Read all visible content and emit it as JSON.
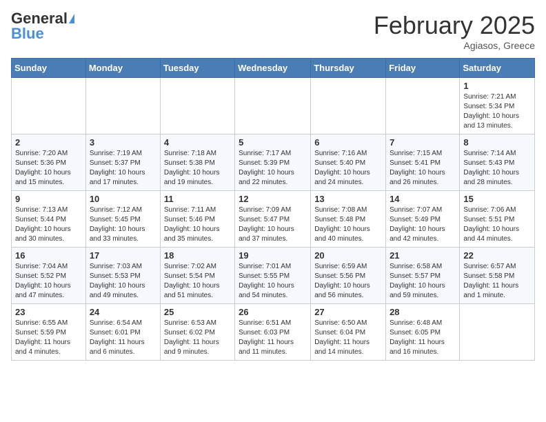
{
  "header": {
    "logo_general": "General",
    "logo_blue": "Blue",
    "title": "February 2025",
    "location": "Agiasos, Greece"
  },
  "weekdays": [
    "Sunday",
    "Monday",
    "Tuesday",
    "Wednesday",
    "Thursday",
    "Friday",
    "Saturday"
  ],
  "weeks": [
    [
      {
        "day": "",
        "info": ""
      },
      {
        "day": "",
        "info": ""
      },
      {
        "day": "",
        "info": ""
      },
      {
        "day": "",
        "info": ""
      },
      {
        "day": "",
        "info": ""
      },
      {
        "day": "",
        "info": ""
      },
      {
        "day": "1",
        "info": "Sunrise: 7:21 AM\nSunset: 5:34 PM\nDaylight: 10 hours\nand 13 minutes."
      }
    ],
    [
      {
        "day": "2",
        "info": "Sunrise: 7:20 AM\nSunset: 5:36 PM\nDaylight: 10 hours\nand 15 minutes."
      },
      {
        "day": "3",
        "info": "Sunrise: 7:19 AM\nSunset: 5:37 PM\nDaylight: 10 hours\nand 17 minutes."
      },
      {
        "day": "4",
        "info": "Sunrise: 7:18 AM\nSunset: 5:38 PM\nDaylight: 10 hours\nand 19 minutes."
      },
      {
        "day": "5",
        "info": "Sunrise: 7:17 AM\nSunset: 5:39 PM\nDaylight: 10 hours\nand 22 minutes."
      },
      {
        "day": "6",
        "info": "Sunrise: 7:16 AM\nSunset: 5:40 PM\nDaylight: 10 hours\nand 24 minutes."
      },
      {
        "day": "7",
        "info": "Sunrise: 7:15 AM\nSunset: 5:41 PM\nDaylight: 10 hours\nand 26 minutes."
      },
      {
        "day": "8",
        "info": "Sunrise: 7:14 AM\nSunset: 5:43 PM\nDaylight: 10 hours\nand 28 minutes."
      }
    ],
    [
      {
        "day": "9",
        "info": "Sunrise: 7:13 AM\nSunset: 5:44 PM\nDaylight: 10 hours\nand 30 minutes."
      },
      {
        "day": "10",
        "info": "Sunrise: 7:12 AM\nSunset: 5:45 PM\nDaylight: 10 hours\nand 33 minutes."
      },
      {
        "day": "11",
        "info": "Sunrise: 7:11 AM\nSunset: 5:46 PM\nDaylight: 10 hours\nand 35 minutes."
      },
      {
        "day": "12",
        "info": "Sunrise: 7:09 AM\nSunset: 5:47 PM\nDaylight: 10 hours\nand 37 minutes."
      },
      {
        "day": "13",
        "info": "Sunrise: 7:08 AM\nSunset: 5:48 PM\nDaylight: 10 hours\nand 40 minutes."
      },
      {
        "day": "14",
        "info": "Sunrise: 7:07 AM\nSunset: 5:49 PM\nDaylight: 10 hours\nand 42 minutes."
      },
      {
        "day": "15",
        "info": "Sunrise: 7:06 AM\nSunset: 5:51 PM\nDaylight: 10 hours\nand 44 minutes."
      }
    ],
    [
      {
        "day": "16",
        "info": "Sunrise: 7:04 AM\nSunset: 5:52 PM\nDaylight: 10 hours\nand 47 minutes."
      },
      {
        "day": "17",
        "info": "Sunrise: 7:03 AM\nSunset: 5:53 PM\nDaylight: 10 hours\nand 49 minutes."
      },
      {
        "day": "18",
        "info": "Sunrise: 7:02 AM\nSunset: 5:54 PM\nDaylight: 10 hours\nand 51 minutes."
      },
      {
        "day": "19",
        "info": "Sunrise: 7:01 AM\nSunset: 5:55 PM\nDaylight: 10 hours\nand 54 minutes."
      },
      {
        "day": "20",
        "info": "Sunrise: 6:59 AM\nSunset: 5:56 PM\nDaylight: 10 hours\nand 56 minutes."
      },
      {
        "day": "21",
        "info": "Sunrise: 6:58 AM\nSunset: 5:57 PM\nDaylight: 10 hours\nand 59 minutes."
      },
      {
        "day": "22",
        "info": "Sunrise: 6:57 AM\nSunset: 5:58 PM\nDaylight: 11 hours\nand 1 minute."
      }
    ],
    [
      {
        "day": "23",
        "info": "Sunrise: 6:55 AM\nSunset: 5:59 PM\nDaylight: 11 hours\nand 4 minutes."
      },
      {
        "day": "24",
        "info": "Sunrise: 6:54 AM\nSunset: 6:01 PM\nDaylight: 11 hours\nand 6 minutes."
      },
      {
        "day": "25",
        "info": "Sunrise: 6:53 AM\nSunset: 6:02 PM\nDaylight: 11 hours\nand 9 minutes."
      },
      {
        "day": "26",
        "info": "Sunrise: 6:51 AM\nSunset: 6:03 PM\nDaylight: 11 hours\nand 11 minutes."
      },
      {
        "day": "27",
        "info": "Sunrise: 6:50 AM\nSunset: 6:04 PM\nDaylight: 11 hours\nand 14 minutes."
      },
      {
        "day": "28",
        "info": "Sunrise: 6:48 AM\nSunset: 6:05 PM\nDaylight: 11 hours\nand 16 minutes."
      },
      {
        "day": "",
        "info": ""
      }
    ]
  ]
}
